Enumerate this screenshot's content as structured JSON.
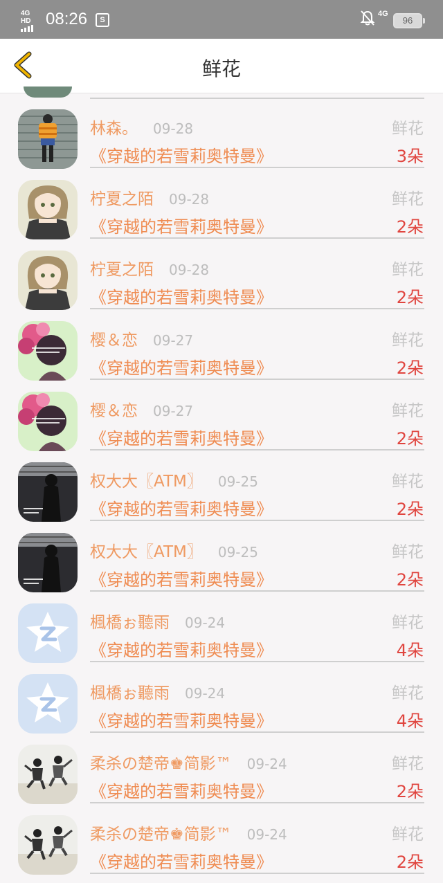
{
  "status_bar": {
    "network_left": "4G HD",
    "time": "08:26",
    "sim_icon": "S",
    "network_right": "4G",
    "battery": "96"
  },
  "header": {
    "title": "鲜花",
    "accent": "#f0b400"
  },
  "colors": {
    "name": "#ef9a62",
    "book": "#ef8c52",
    "count": "#e0453f",
    "muted": "#bdbdbd"
  },
  "rows": [
    {
      "name": "林森。",
      "date": "09-28",
      "kind": "鲜花",
      "book": "《穿越的若雪莉奥特曼》",
      "count": "3朵",
      "avatar": "orange-striped-person"
    },
    {
      "name": "柠夏之陌",
      "date": "09-28",
      "kind": "鲜花",
      "book": "《穿越的若雪莉奥特曼》",
      "count": "2朵",
      "avatar": "anime-girl"
    },
    {
      "name": "柠夏之陌",
      "date": "09-28",
      "kind": "鲜花",
      "book": "《穿越的若雪莉奥特曼》",
      "count": "2朵",
      "avatar": "anime-girl"
    },
    {
      "name": "樱＆恋",
      "date": "09-27",
      "kind": "鲜花",
      "book": "《穿越的若雪莉奥特曼》",
      "count": "2朵",
      "avatar": "flowers-girl"
    },
    {
      "name": "樱＆恋",
      "date": "09-27",
      "kind": "鲜花",
      "book": "《穿越的若雪莉奥特曼》",
      "count": "2朵",
      "avatar": "flowers-girl"
    },
    {
      "name": "权大大〖ATM〗",
      "date": "09-25",
      "kind": "鲜花",
      "book": "《穿越的若雪莉奥特曼》",
      "count": "2朵",
      "avatar": "dark-silhouette"
    },
    {
      "name": "权大大〖ATM〗",
      "date": "09-25",
      "kind": "鲜花",
      "book": "《穿越的若雪莉奥特曼》",
      "count": "2朵",
      "avatar": "dark-silhouette"
    },
    {
      "name": "楓橋ぉ聽雨",
      "date": "09-24",
      "kind": "鲜花",
      "book": "《穿越的若雪莉奥特曼》",
      "count": "4朵",
      "avatar": "default-star"
    },
    {
      "name": "楓橋ぉ聽雨",
      "date": "09-24",
      "kind": "鲜花",
      "book": "《穿越的若雪莉奥特曼》",
      "count": "4朵",
      "avatar": "default-star"
    },
    {
      "name": "柔杀の楚帝♚简影™",
      "date": "09-24",
      "kind": "鲜花",
      "book": "《穿越的若雪莉奥特曼》",
      "count": "2朵",
      "avatar": "jumping-couple"
    },
    {
      "name": "柔杀の楚帝♚简影™",
      "date": "09-24",
      "kind": "鲜花",
      "book": "《穿越的若雪莉奥特曼》",
      "count": "2朵",
      "avatar": "jumping-couple"
    }
  ]
}
